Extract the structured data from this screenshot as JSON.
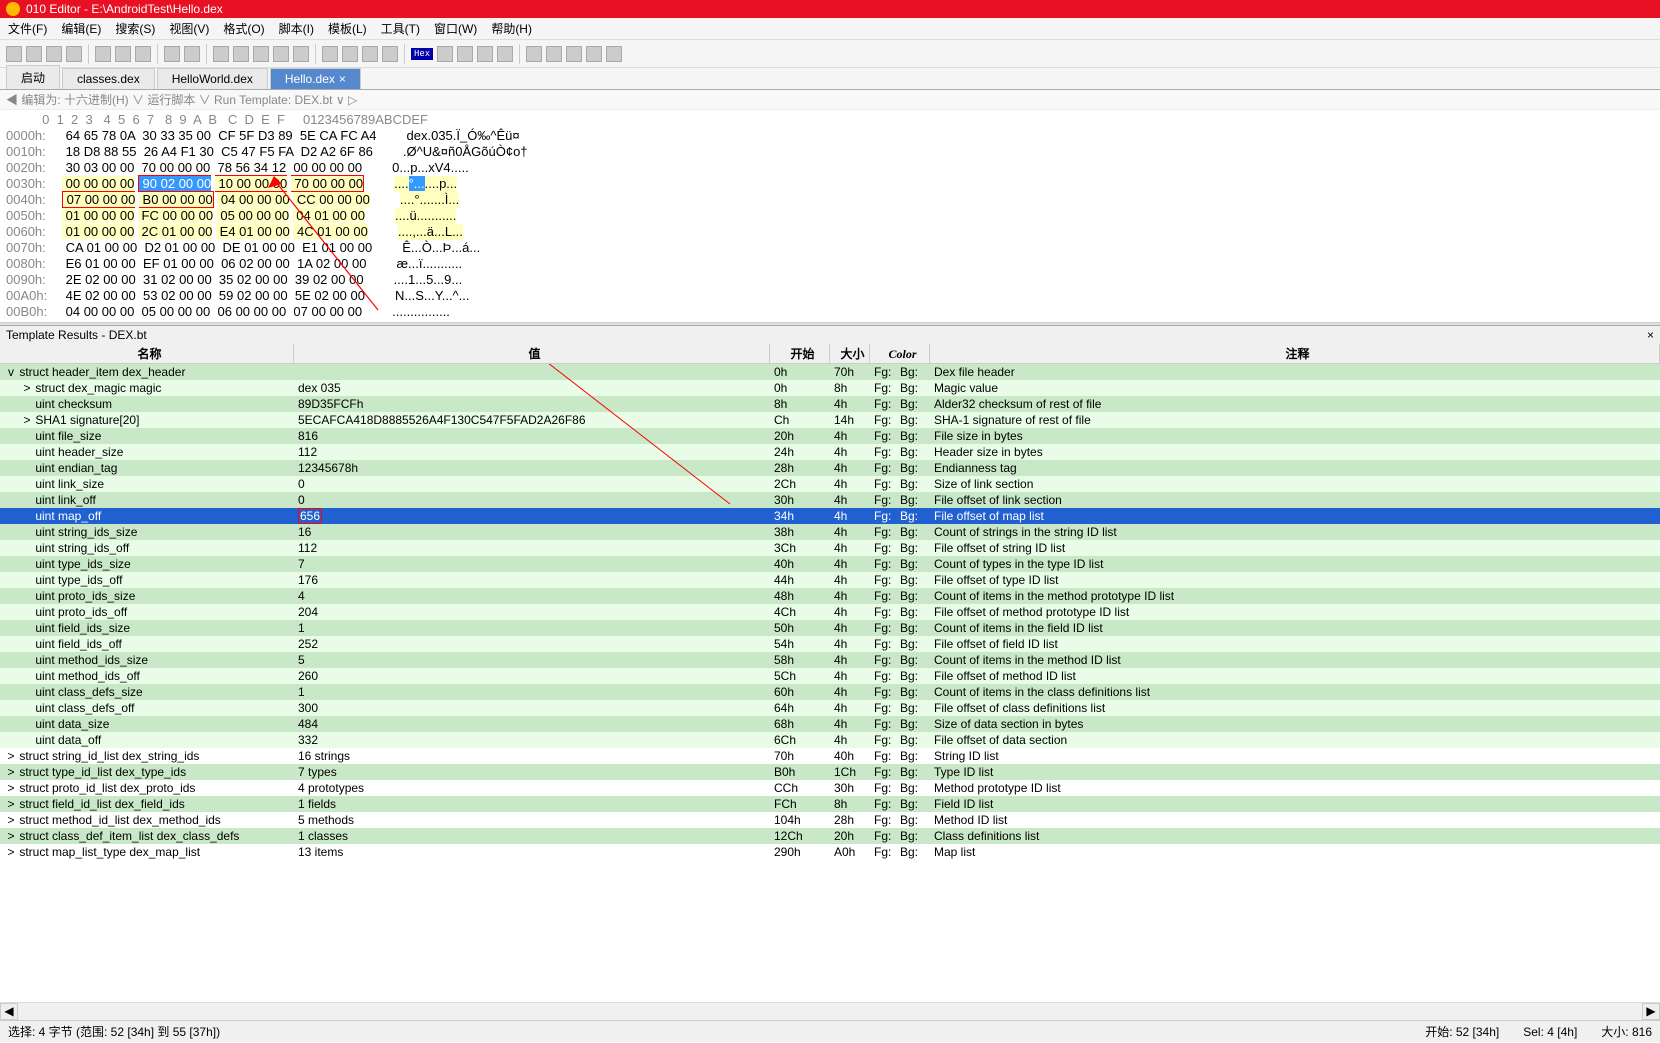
{
  "title": "010 Editor - E:\\AndroidTest\\Hello.dex",
  "menu": [
    "文件(F)",
    "编辑(E)",
    "搜索(S)",
    "视图(V)",
    "格式(O)",
    "脚本(I)",
    "模板(L)",
    "工具(T)",
    "窗口(W)",
    "帮助(H)"
  ],
  "tabs": [
    {
      "label": "启动"
    },
    {
      "label": "classes.dex"
    },
    {
      "label": "HelloWorld.dex"
    },
    {
      "label": "Hello.dex",
      "active": true,
      "closable": true
    }
  ],
  "breadcrumb": {
    "prefix": "◀  编辑为: 十六进制(H) ∨   运行脚本 ∨   Run Template: DEX.bt ∨ ▷"
  },
  "hex": {
    "cols_header": "          0  1  2  3   4  5  6  7   8  9  A  B   C  D  E  F",
    "ascii_header": "  0123456789ABCDEF",
    "rows": [
      {
        "addr": "0000h:",
        "bytes": [
          [
            "64",
            "65",
            "78",
            "0A"
          ],
          [
            "30",
            "33",
            "35",
            "00"
          ],
          [
            "CF",
            "5F",
            "D3",
            "89"
          ],
          [
            "5E",
            "CA",
            "FC",
            "A4"
          ]
        ],
        "ascii": "dex.035.Ï_Ó‰^Êü¤"
      },
      {
        "addr": "0010h:",
        "bytes": [
          [
            "18",
            "D8",
            "88",
            "55"
          ],
          [
            "26",
            "A4",
            "F1",
            "30"
          ],
          [
            "C5",
            "47",
            "F5",
            "FA"
          ],
          [
            "D2",
            "A2",
            "6F",
            "86"
          ]
        ],
        "ascii": ".Ø^U&¤ñ0ÅGõúÒ¢o†"
      },
      {
        "addr": "0020h:",
        "bytes": [
          [
            "30",
            "03",
            "00",
            "00"
          ],
          [
            "70",
            "00",
            "00",
            "00"
          ],
          [
            "78",
            "56",
            "34",
            "12"
          ],
          [
            "00",
            "00",
            "00",
            "00"
          ]
        ],
        "ascii": "0...p...xV4....."
      },
      {
        "addr": "0030h:",
        "bytes": [
          [
            "00",
            "00",
            "00",
            "00"
          ],
          [
            "90",
            "02",
            "00",
            "00"
          ],
          [
            "10",
            "00",
            "00",
            "00"
          ],
          [
            "70",
            "00",
            "00",
            "00"
          ]
        ],
        "ascii": "....°.......p...",
        "hl": "yellow",
        "sel": [
          4,
          7
        ],
        "redbox": [
          4,
          15
        ]
      },
      {
        "addr": "0040h:",
        "bytes": [
          [
            "07",
            "00",
            "00",
            "00"
          ],
          [
            "B0",
            "00",
            "00",
            "00"
          ],
          [
            "04",
            "00",
            "00",
            "00"
          ],
          [
            "CC",
            "00",
            "00",
            "00"
          ]
        ],
        "ascii": "....°.......Ì...",
        "hl": "yellow",
        "redbox": [
          0,
          7
        ]
      },
      {
        "addr": "0050h:",
        "bytes": [
          [
            "01",
            "00",
            "00",
            "00"
          ],
          [
            "FC",
            "00",
            "00",
            "00"
          ],
          [
            "05",
            "00",
            "00",
            "00"
          ],
          [
            "04",
            "01",
            "00",
            "00"
          ]
        ],
        "ascii": "....ü...........",
        "hl": "yellow"
      },
      {
        "addr": "0060h:",
        "bytes": [
          [
            "01",
            "00",
            "00",
            "00"
          ],
          [
            "2C",
            "01",
            "00",
            "00"
          ],
          [
            "E4",
            "01",
            "00",
            "00"
          ],
          [
            "4C",
            "01",
            "00",
            "00"
          ]
        ],
        "ascii": "....,...ä...L...",
        "hl": "yellow"
      },
      {
        "addr": "0070h:",
        "bytes": [
          [
            "CA",
            "01",
            "00",
            "00"
          ],
          [
            "D2",
            "01",
            "00",
            "00"
          ],
          [
            "DE",
            "01",
            "00",
            "00"
          ],
          [
            "E1",
            "01",
            "00",
            "00"
          ]
        ],
        "ascii": "Ê...Ò...Þ...á..."
      },
      {
        "addr": "0080h:",
        "bytes": [
          [
            "E6",
            "01",
            "00",
            "00"
          ],
          [
            "EF",
            "01",
            "00",
            "00"
          ],
          [
            "06",
            "02",
            "00",
            "00"
          ],
          [
            "1A",
            "02",
            "00",
            "00"
          ]
        ],
        "ascii": "æ...ï..........."
      },
      {
        "addr": "0090h:",
        "bytes": [
          [
            "2E",
            "02",
            "00",
            "00"
          ],
          [
            "31",
            "02",
            "00",
            "00"
          ],
          [
            "35",
            "02",
            "00",
            "00"
          ],
          [
            "39",
            "02",
            "00",
            "00"
          ]
        ],
        "ascii": "....1...5...9..."
      },
      {
        "addr": "00A0h:",
        "bytes": [
          [
            "4E",
            "02",
            "00",
            "00"
          ],
          [
            "53",
            "02",
            "00",
            "00"
          ],
          [
            "59",
            "02",
            "00",
            "00"
          ],
          [
            "5E",
            "02",
            "00",
            "00"
          ]
        ],
        "ascii": "N...S...Y...^..."
      },
      {
        "addr": "00B0h:",
        "bytes": [
          [
            "04",
            "00",
            "00",
            "00"
          ],
          [
            "05",
            "00",
            "00",
            "00"
          ],
          [
            "06",
            "00",
            "00",
            "00"
          ],
          [
            "07",
            "00",
            "00",
            "00"
          ]
        ],
        "ascii": "................"
      }
    ]
  },
  "template_title": "Template Results - DEX.bt",
  "template_headers": {
    "name": "名称",
    "value": "值",
    "start": "开始",
    "size": "大小",
    "color": "Color",
    "comment": "注释"
  },
  "template_rows": [
    {
      "depth": 0,
      "toggle": "v",
      "name": "struct header_item dex_header",
      "value": "",
      "start": "0h",
      "size": "70h",
      "fg": "Fg:",
      "bg": "Bg:",
      "comment": "Dex file header",
      "stripe": "even"
    },
    {
      "depth": 1,
      "toggle": ">",
      "name": "struct dex_magic magic",
      "value": "dex 035",
      "start": "0h",
      "size": "8h",
      "fg": "Fg:",
      "bg": "Bg:",
      "comment": "Magic value",
      "stripe": "odd"
    },
    {
      "depth": 1,
      "name": "uint checksum",
      "value": "89D35FCFh",
      "start": "8h",
      "size": "4h",
      "fg": "Fg:",
      "bg": "Bg:",
      "comment": "Alder32 checksum of rest of file",
      "stripe": "even"
    },
    {
      "depth": 1,
      "toggle": ">",
      "name": "SHA1 signature[20]",
      "value": "5ECAFCA418D8885526A4F130C547F5FAD2A26F86",
      "start": "Ch",
      "size": "14h",
      "fg": "Fg:",
      "bg": "Bg:",
      "comment": "SHA-1 signature of rest of file",
      "stripe": "odd"
    },
    {
      "depth": 1,
      "name": "uint file_size",
      "value": "816",
      "start": "20h",
      "size": "4h",
      "fg": "Fg:",
      "bg": "Bg:",
      "comment": "File size in bytes",
      "stripe": "even"
    },
    {
      "depth": 1,
      "name": "uint header_size",
      "value": "112",
      "start": "24h",
      "size": "4h",
      "fg": "Fg:",
      "bg": "Bg:",
      "comment": "Header size in bytes",
      "stripe": "odd"
    },
    {
      "depth": 1,
      "name": "uint endian_tag",
      "value": "12345678h",
      "start": "28h",
      "size": "4h",
      "fg": "Fg:",
      "bg": "Bg:",
      "comment": "Endianness tag",
      "stripe": "even"
    },
    {
      "depth": 1,
      "name": "uint link_size",
      "value": "0",
      "start": "2Ch",
      "size": "4h",
      "fg": "Fg:",
      "bg": "Bg:",
      "comment": "Size of link section",
      "stripe": "odd"
    },
    {
      "depth": 1,
      "name": "uint link_off",
      "value": "0",
      "start": "30h",
      "size": "4h",
      "fg": "Fg:",
      "bg": "Bg:",
      "comment": "File offset of link section",
      "stripe": "even"
    },
    {
      "depth": 1,
      "name": "uint map_off",
      "value": "656",
      "start": "34h",
      "size": "4h",
      "fg": "Fg:",
      "bg": "Bg:",
      "comment": "File offset of map list",
      "stripe": "sel",
      "redbox": true
    },
    {
      "depth": 1,
      "name": "uint string_ids_size",
      "value": "16",
      "start": "38h",
      "size": "4h",
      "fg": "Fg:",
      "bg": "Bg:",
      "comment": "Count of strings in the string ID list",
      "stripe": "even"
    },
    {
      "depth": 1,
      "name": "uint string_ids_off",
      "value": "112",
      "start": "3Ch",
      "size": "4h",
      "fg": "Fg:",
      "bg": "Bg:",
      "comment": "File offset of string ID list",
      "stripe": "odd"
    },
    {
      "depth": 1,
      "name": "uint type_ids_size",
      "value": "7",
      "start": "40h",
      "size": "4h",
      "fg": "Fg:",
      "bg": "Bg:",
      "comment": "Count of types in the type ID list",
      "stripe": "even"
    },
    {
      "depth": 1,
      "name": "uint type_ids_off",
      "value": "176",
      "start": "44h",
      "size": "4h",
      "fg": "Fg:",
      "bg": "Bg:",
      "comment": "File offset of type ID list",
      "stripe": "odd"
    },
    {
      "depth": 1,
      "name": "uint proto_ids_size",
      "value": "4",
      "start": "48h",
      "size": "4h",
      "fg": "Fg:",
      "bg": "Bg:",
      "comment": "Count of items in the method prototype ID list",
      "stripe": "even"
    },
    {
      "depth": 1,
      "name": "uint proto_ids_off",
      "value": "204",
      "start": "4Ch",
      "size": "4h",
      "fg": "Fg:",
      "bg": "Bg:",
      "comment": "File offset of method prototype ID list",
      "stripe": "odd"
    },
    {
      "depth": 1,
      "name": "uint field_ids_size",
      "value": "1",
      "start": "50h",
      "size": "4h",
      "fg": "Fg:",
      "bg": "Bg:",
      "comment": "Count of items in the field ID list",
      "stripe": "even"
    },
    {
      "depth": 1,
      "name": "uint field_ids_off",
      "value": "252",
      "start": "54h",
      "size": "4h",
      "fg": "Fg:",
      "bg": "Bg:",
      "comment": "File offset of field ID list",
      "stripe": "odd"
    },
    {
      "depth": 1,
      "name": "uint method_ids_size",
      "value": "5",
      "start": "58h",
      "size": "4h",
      "fg": "Fg:",
      "bg": "Bg:",
      "comment": "Count of items in the method ID list",
      "stripe": "even"
    },
    {
      "depth": 1,
      "name": "uint method_ids_off",
      "value": "260",
      "start": "5Ch",
      "size": "4h",
      "fg": "Fg:",
      "bg": "Bg:",
      "comment": "File offset of method ID list",
      "stripe": "odd"
    },
    {
      "depth": 1,
      "name": "uint class_defs_size",
      "value": "1",
      "start": "60h",
      "size": "4h",
      "fg": "Fg:",
      "bg": "Bg:",
      "comment": "Count of items in the class definitions list",
      "stripe": "even"
    },
    {
      "depth": 1,
      "name": "uint class_defs_off",
      "value": "300",
      "start": "64h",
      "size": "4h",
      "fg": "Fg:",
      "bg": "Bg:",
      "comment": "File offset of class definitions list",
      "stripe": "odd"
    },
    {
      "depth": 1,
      "name": "uint data_size",
      "value": "484",
      "start": "68h",
      "size": "4h",
      "fg": "Fg:",
      "bg": "Bg:",
      "comment": "Size of data section in bytes",
      "stripe": "even"
    },
    {
      "depth": 1,
      "name": "uint data_off",
      "value": "332",
      "start": "6Ch",
      "size": "4h",
      "fg": "Fg:",
      "bg": "Bg:",
      "comment": "File offset of data section",
      "stripe": "odd"
    },
    {
      "depth": 0,
      "toggle": ">",
      "name": "struct string_id_list dex_string_ids",
      "value": "16 strings",
      "start": "70h",
      "size": "40h",
      "fg": "Fg:",
      "bg": "Bg:",
      "comment": "String ID list",
      "stripe": "plain"
    },
    {
      "depth": 0,
      "toggle": ">",
      "name": "struct type_id_list dex_type_ids",
      "value": "7 types",
      "start": "B0h",
      "size": "1Ch",
      "fg": "Fg:",
      "bg": "Bg:",
      "comment": "Type ID list",
      "stripe": "even"
    },
    {
      "depth": 0,
      "toggle": ">",
      "name": "struct proto_id_list dex_proto_ids",
      "value": "4 prototypes",
      "start": "CCh",
      "size": "30h",
      "fg": "Fg:",
      "bg": "Bg:",
      "comment": "Method prototype ID list",
      "stripe": "plain"
    },
    {
      "depth": 0,
      "toggle": ">",
      "name": "struct field_id_list dex_field_ids",
      "value": "1 fields",
      "start": "FCh",
      "size": "8h",
      "fg": "Fg:",
      "bg": "Bg:",
      "comment": "Field ID list",
      "stripe": "even"
    },
    {
      "depth": 0,
      "toggle": ">",
      "name": "struct method_id_list dex_method_ids",
      "value": "5 methods",
      "start": "104h",
      "size": "28h",
      "fg": "Fg:",
      "bg": "Bg:",
      "comment": "Method ID list",
      "stripe": "plain"
    },
    {
      "depth": 0,
      "toggle": ">",
      "name": "struct class_def_item_list dex_class_defs",
      "value": "1 classes",
      "start": "12Ch",
      "size": "20h",
      "fg": "Fg:",
      "bg": "Bg:",
      "comment": "Class definitions list",
      "stripe": "even"
    },
    {
      "depth": 0,
      "toggle": ">",
      "name": "struct map_list_type dex_map_list",
      "value": "13 items",
      "start": "290h",
      "size": "A0h",
      "fg": "Fg:",
      "bg": "Bg:",
      "comment": "Map list",
      "stripe": "plain"
    }
  ],
  "status": {
    "left": "选择: 4 字节 (范围: 52 [34h] 到 55 [37h])",
    "pos": "开始: 52 [34h]",
    "sel": "Sel: 4 [4h]",
    "size": "大小: 816"
  }
}
